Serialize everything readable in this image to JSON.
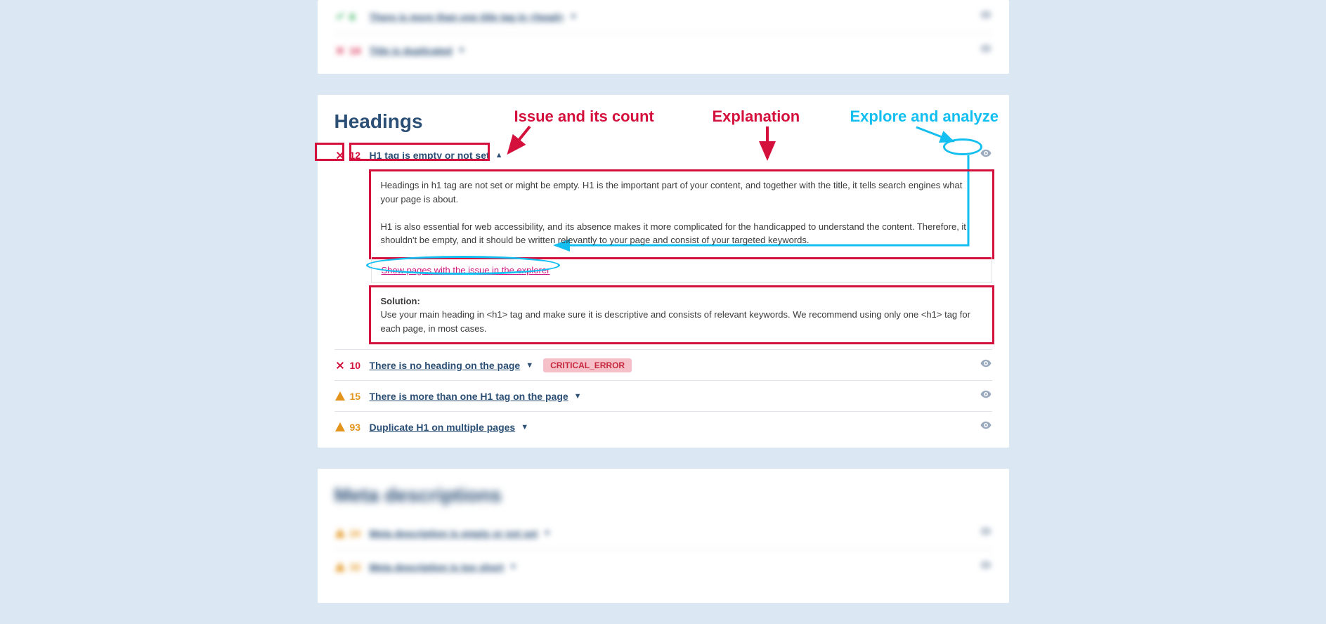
{
  "annotations": {
    "issue_count_label": "Issue and its count",
    "explanation_label": "Explanation",
    "explore_label": "Explore and analyze"
  },
  "top_card": {
    "rows": [
      {
        "status": "ok",
        "count": "8",
        "label": "There is more than one title tag in <head>"
      },
      {
        "status": "error",
        "count": "14",
        "label": "Title is duplicated"
      }
    ]
  },
  "headings": {
    "title": "Headings",
    "expanded": {
      "count": "12",
      "label": "H1 tag is empty or not set",
      "explanation_p1": "Headings in h1 tag are not set or might be empty. H1 is the important part of your content, and together with the title, it tells search engines what your page is about.",
      "explanation_p2": "H1 is also essential for web accessibility, and its absence makes it more complicated for the handicapped to understand the content. Therefore, it shouldn't be empty, and it should be written relevantly to your page and consist of your targeted keywords.",
      "show_link": "Show pages with the issue in the explorer",
      "solution_label": "Solution:",
      "solution_text": "Use your main heading in <h1> tag and make sure it is descriptive and consists of relevant keywords. We recommend using only one <h1> tag for each page, in most cases."
    },
    "rows": [
      {
        "status": "error",
        "count": "10",
        "label": "There is no heading on the page",
        "badge": "CRITICAL_ERROR"
      },
      {
        "status": "warn",
        "count": "15",
        "label": "There is more than one H1 tag on the page"
      },
      {
        "status": "warn",
        "count": "93",
        "label": "Duplicate H1 on multiple pages"
      }
    ]
  },
  "meta": {
    "title": "Meta descriptions",
    "rows": [
      {
        "status": "warn",
        "count": "24",
        "label": "Meta description is empty or not set"
      },
      {
        "status": "warn",
        "count": "33",
        "label": "Meta description is too short"
      }
    ]
  }
}
